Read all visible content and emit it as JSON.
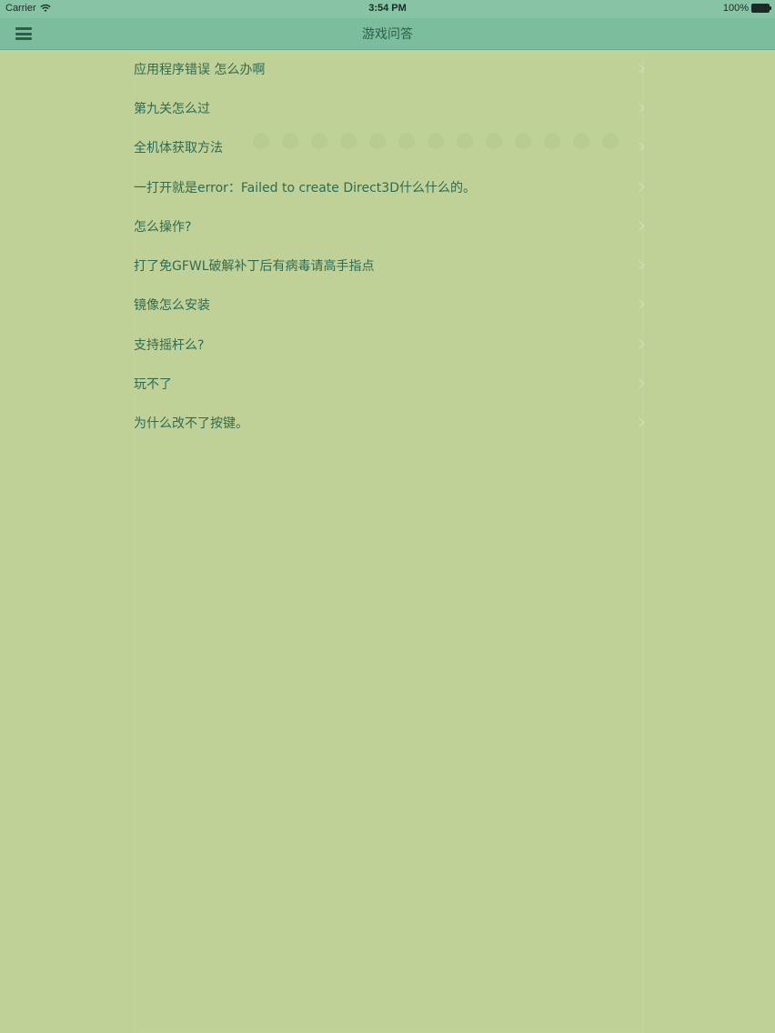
{
  "status_bar": {
    "carrier": "Carrier",
    "time": "3:54 PM",
    "battery": "100%"
  },
  "nav": {
    "title": "游戏问答",
    "menu_icon": "hamburger-menu-icon"
  },
  "questions": [
    "应用程序错误 怎么办啊",
    "第九关怎么过",
    "全机体获取方法",
    "一打开就是error：Failed to create Direct3D什么什么的。",
    "怎么操作?",
    "打了免GFWL破解补丁后有病毒请高手指点",
    "镜像怎么安装",
    "支持摇杆么?",
    "玩不了",
    "为什么改不了按键。"
  ],
  "colors": {
    "background": "#bfd196",
    "nav_bar": "#7cbd9e",
    "text": "#2f6b53"
  }
}
